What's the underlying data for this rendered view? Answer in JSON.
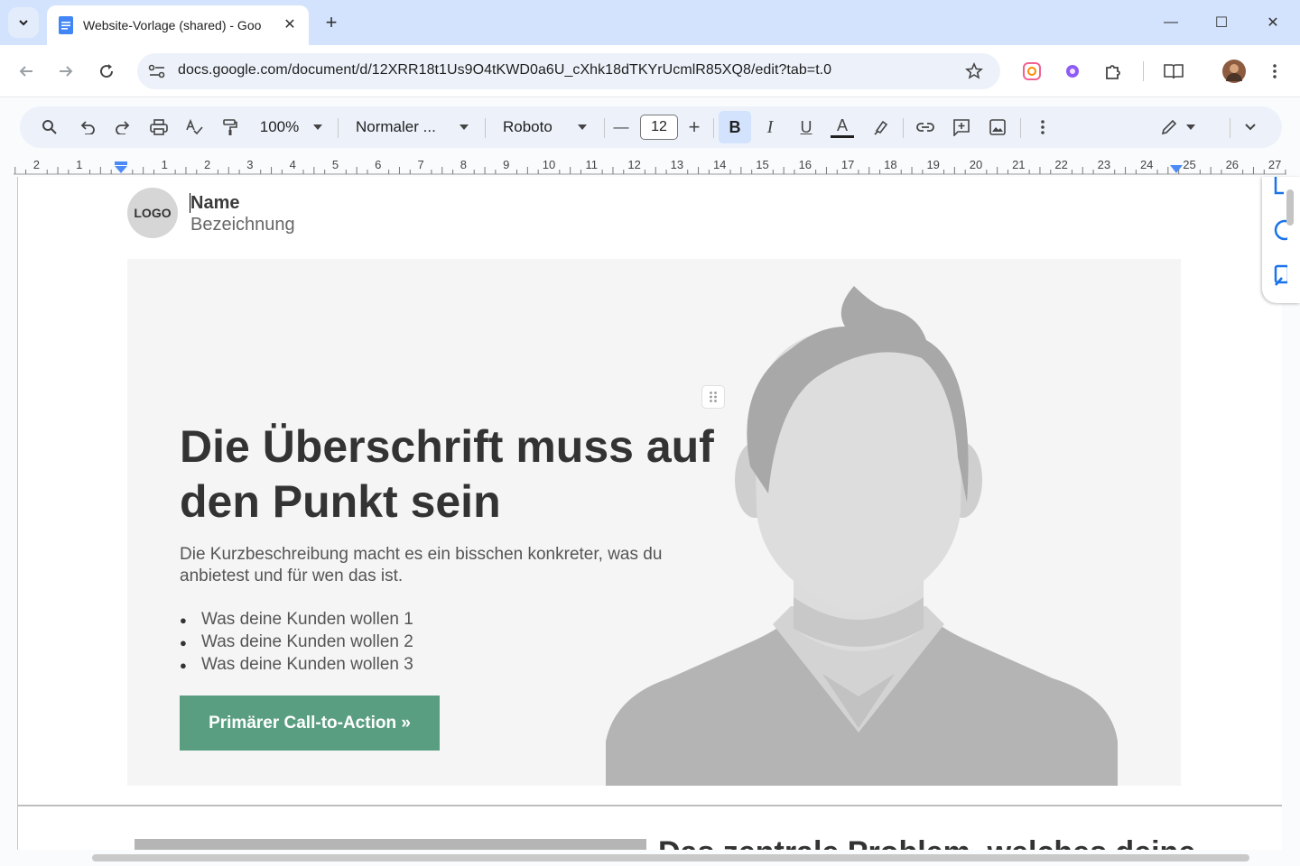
{
  "browser": {
    "tab_title": "Website-Vorlage (shared) - Goo",
    "url": "docs.google.com/document/d/12XRR18t1Us9O4tKWD0a6U_cXhk18dTKYrUcmlR85XQ8/edit?tab=t.0",
    "new_tab_label": "+",
    "tab_close_glyph": "✕",
    "window_minimize": "—",
    "window_maximize": "☐",
    "window_close": "✕"
  },
  "toolbar": {
    "zoom": "100%",
    "style": "Normaler ...",
    "font": "Roboto",
    "font_size": "12",
    "decrease_label": "—",
    "increase_label": "+",
    "bold_label": "B",
    "italic_label": "I",
    "underline_label": "U",
    "text_color_label": "A"
  },
  "ruler": {
    "labels": [
      "2",
      "1",
      "1",
      "2",
      "3",
      "4",
      "5",
      "6",
      "7",
      "8",
      "9",
      "10",
      "11",
      "12",
      "13",
      "14",
      "15",
      "16",
      "17",
      "18",
      "19",
      "20",
      "21",
      "22",
      "23",
      "24",
      "25",
      "26",
      "27"
    ]
  },
  "document": {
    "logo": "LOGO",
    "name": "Name",
    "designation": "Bezeichnung",
    "headline": "Die Überschrift muss auf den Punkt sein",
    "subtitle": "Die Kurzbeschreibung macht es ein bisschen konkreter, was du anbietest und für wen das ist.",
    "bullets": [
      "Was deine Kunden wollen 1",
      "Was deine Kunden wollen 2",
      "Was deine Kunden wollen 3"
    ],
    "cta": "Primärer Call-to-Action »",
    "next_heading": "Das zentrale Problem, welches deine"
  },
  "colors": {
    "tabbar": "#d3e3fd",
    "cta": "#5a9e82",
    "hero_bg": "#f5f5f5",
    "accent_blue": "#1a73e8"
  }
}
